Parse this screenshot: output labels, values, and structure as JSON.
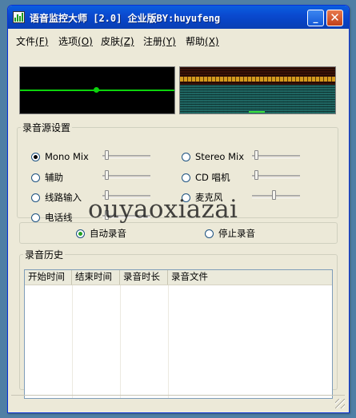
{
  "window": {
    "title": "语音监控大师 [2.0] 企业版BY:huyufeng",
    "minimize_label": "_",
    "close_label": "✕",
    "app_icon": "bar-chart-icon"
  },
  "menu": [
    {
      "label": "文件",
      "accel": "(F)"
    },
    {
      "label": "选项",
      "accel": "(O)"
    },
    {
      "label": "皮肤",
      "accel": "(Z)"
    },
    {
      "label": "注册",
      "accel": "(Y)"
    },
    {
      "label": "帮助",
      "accel": "(X)"
    }
  ],
  "source_settings": {
    "legend": "录音源设置",
    "options": [
      {
        "label": "Mono Mix",
        "selected": true,
        "level": 0.05
      },
      {
        "label": "Stereo Mix",
        "selected": false,
        "level": 0.05
      },
      {
        "label": "辅助",
        "selected": false,
        "level": 0.05
      },
      {
        "label": "CD 唱机",
        "selected": false,
        "level": 0.05
      },
      {
        "label": "线路输入",
        "selected": false,
        "level": 0.05
      },
      {
        "label": "麦克风",
        "selected": false,
        "level": 0.45
      },
      {
        "label": "电话线",
        "selected": false,
        "level": 0.05
      }
    ]
  },
  "recording": {
    "auto_label": "自动录音",
    "stop_label": "停止录音",
    "mode": "auto"
  },
  "history": {
    "legend": "录音历史",
    "columns": [
      "开始时间",
      "结束时间",
      "录音时长",
      "录音文件"
    ],
    "rows": []
  },
  "watermark": "ouyaoxiazai",
  "colors": {
    "title_bar": "#0a4ad0",
    "scope_line": "#0cd30c",
    "window_bg": "#ece9d8"
  }
}
